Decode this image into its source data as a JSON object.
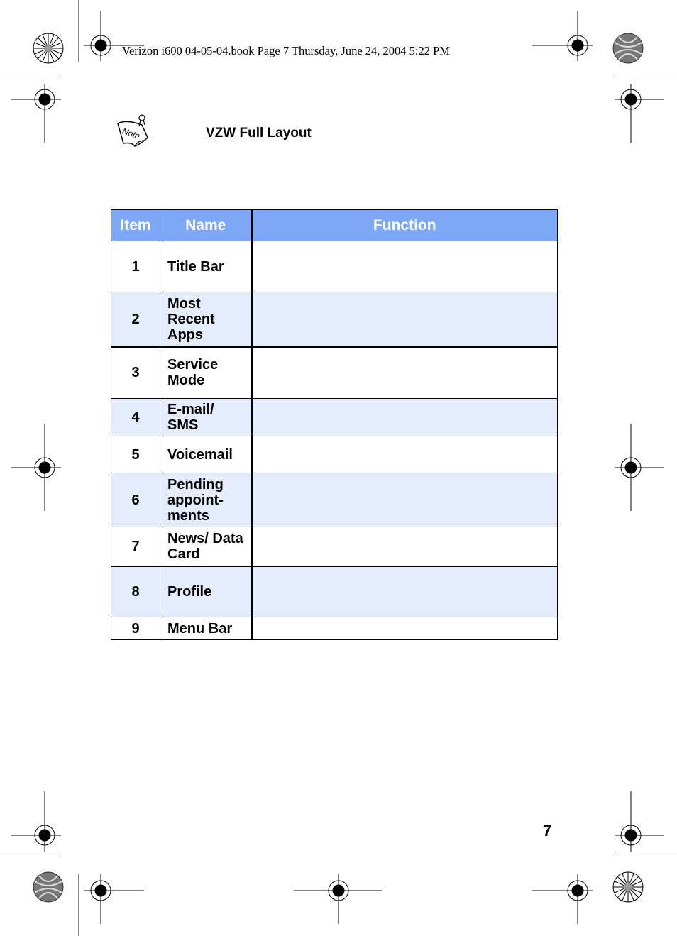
{
  "print_header": "Verizon i600 04-05-04.book  Page 7  Thursday, June 24, 2004  5:22 PM",
  "note": {
    "icon": "note-icon",
    "label": "Note"
  },
  "heading": "VZW Full Layout",
  "table": {
    "columns": [
      "Item",
      "Name",
      "Function"
    ],
    "header_color": "#7ea7f5",
    "alt_row_color": "#e5ecfb",
    "rows": [
      {
        "item": "1",
        "name": "Title Bar",
        "function": ""
      },
      {
        "item": "2",
        "name": "Most Recent Apps",
        "function": ""
      },
      {
        "item": "3",
        "name": "Service Mode",
        "function": ""
      },
      {
        "item": "4",
        "name": "E-mail/ SMS",
        "function": ""
      },
      {
        "item": "5",
        "name": "Voicemail",
        "function": ""
      },
      {
        "item": "6",
        "name": "Pending appoint-ments",
        "function": ""
      },
      {
        "item": "7",
        "name": "News/ Data Card",
        "function": ""
      },
      {
        "item": "8",
        "name": "Profile",
        "function": ""
      },
      {
        "item": "9",
        "name": "Menu Bar",
        "function": ""
      }
    ]
  },
  "page_number": "7"
}
